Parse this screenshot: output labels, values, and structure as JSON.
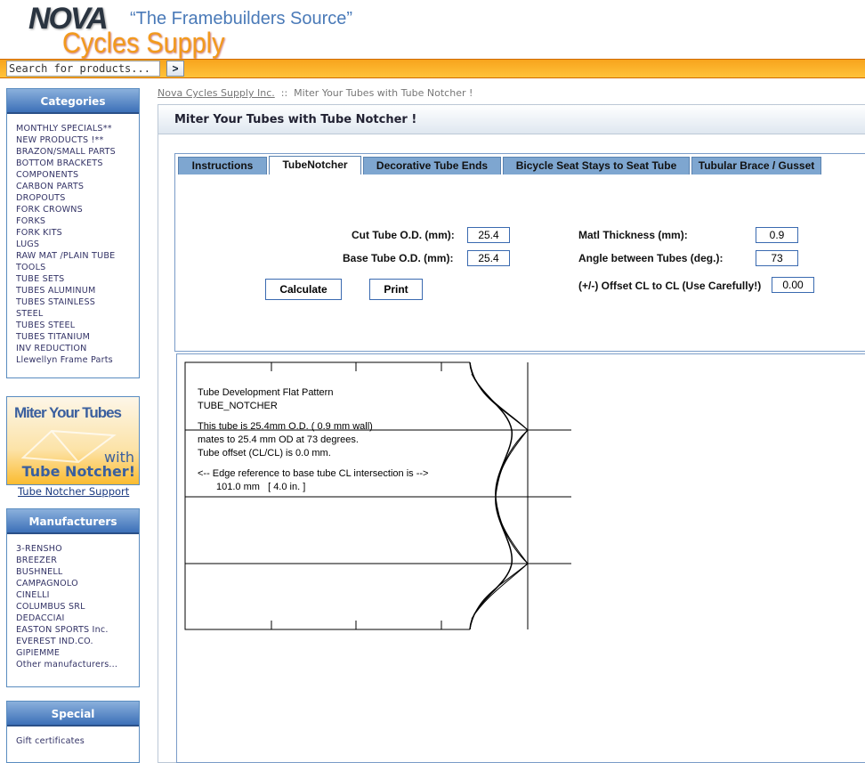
{
  "header": {
    "logo_top": "NOVA",
    "logo_bottom": "Cycles Supply",
    "tagline": "“The Framebuilders Source”"
  },
  "search": {
    "placeholder": "Search for products...",
    "value": "Search for products...",
    "go_label": ">"
  },
  "categories": {
    "title": "Categories",
    "items": [
      "MONTHLY SPECIALS**",
      "NEW PRODUCTS !**",
      "BRAZON/SMALL PARTS",
      "BOTTOM BRACKETS",
      "COMPONENTS",
      "CARBON PARTS",
      "DROPOUTS",
      "FORK CROWNS",
      "FORKS",
      "FORK KITS",
      "LUGS",
      "RAW MAT /PLAIN TUBE",
      "TOOLS",
      "TUBE SETS",
      "TUBES ALUMINUM",
      "TUBES STAINLESS",
      "STEEL",
      "TUBES STEEL",
      "TUBES TITANIUM",
      "INV REDUCTION",
      "Llewellyn Frame Parts"
    ]
  },
  "banner": {
    "line1": "Miter Your Tubes",
    "line2": "with",
    "line3": "Tube Notcher!",
    "link": "Tube Notcher Support"
  },
  "manufacturers": {
    "title": "Manufacturers",
    "items": [
      "3-RENSHO",
      "BREEZER",
      "BUSHNELL",
      "CAMPAGNOLO",
      "CINELLI",
      "COLUMBUS SRL",
      "DEDACCIAI",
      "EASTON SPORTS Inc.",
      "EVEREST IND.CO.",
      "GIPIEMME",
      "Other manufacturers..."
    ]
  },
  "special": {
    "title": "Special",
    "items": [
      "Gift certificates"
    ]
  },
  "breadcrumb": {
    "home": "Nova Cycles Supply Inc.",
    "sep": "::",
    "current": "Miter Your Tubes with Tube Notcher !"
  },
  "page_title": "Miter Your Tubes with Tube Notcher !",
  "tabs": [
    {
      "label": "Instructions"
    },
    {
      "label": "TubeNotcher",
      "active": true
    },
    {
      "label": "Decorative Tube Ends"
    },
    {
      "label": "Bicycle Seat Stays to Seat Tube"
    },
    {
      "label": "Tubular Brace / Gusset"
    }
  ],
  "form": {
    "cut_od_label": "Cut Tube O.D. (mm):",
    "cut_od": "25.4",
    "base_od_label": "Base Tube O.D. (mm):",
    "base_od": "25.4",
    "thickness_label": "Matl Thickness (mm):",
    "thickness": "0.9",
    "angle_label": "Angle between Tubes (deg.):",
    "angle": "73",
    "offset_label": "(+/-) Offset CL to CL (Use Carefully!)",
    "offset": "0.00",
    "calculate": "Calculate",
    "print": "Print"
  },
  "pattern": {
    "lines": [
      "Tube Development Flat Pattern",
      "TUBE_NOTCHER",
      "This tube is 25.4mm O.D. ( 0.9 mm wall)",
      "mates to 25.4 mm OD at 73 degrees.",
      "Tube offset (CL/CL) is 0.0 mm.",
      "<-- Edge reference to base tube CL intersection is -->",
      "101.0 mm   [ 4.0 in. ]"
    ]
  }
}
